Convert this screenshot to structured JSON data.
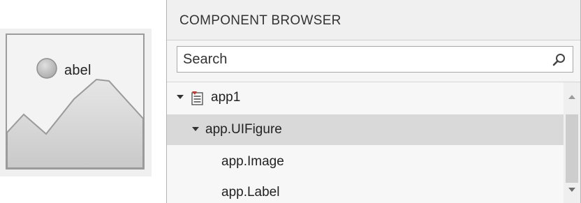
{
  "preview": {
    "overlay_label": "abel",
    "placeholder_icon": "image-placeholder-icon"
  },
  "browser": {
    "title": "COMPONENT BROWSER",
    "search": {
      "placeholder": "Search",
      "value": ""
    },
    "tree": [
      {
        "label": "app1",
        "level": 0,
        "expanded": true,
        "selected": false,
        "icon": "app-file-icon"
      },
      {
        "label": "app.UIFigure",
        "level": 1,
        "expanded": true,
        "selected": true
      },
      {
        "label": "app.Image",
        "level": 2,
        "selected": false
      },
      {
        "label": "app.Label",
        "level": 2,
        "selected": false
      }
    ]
  }
}
